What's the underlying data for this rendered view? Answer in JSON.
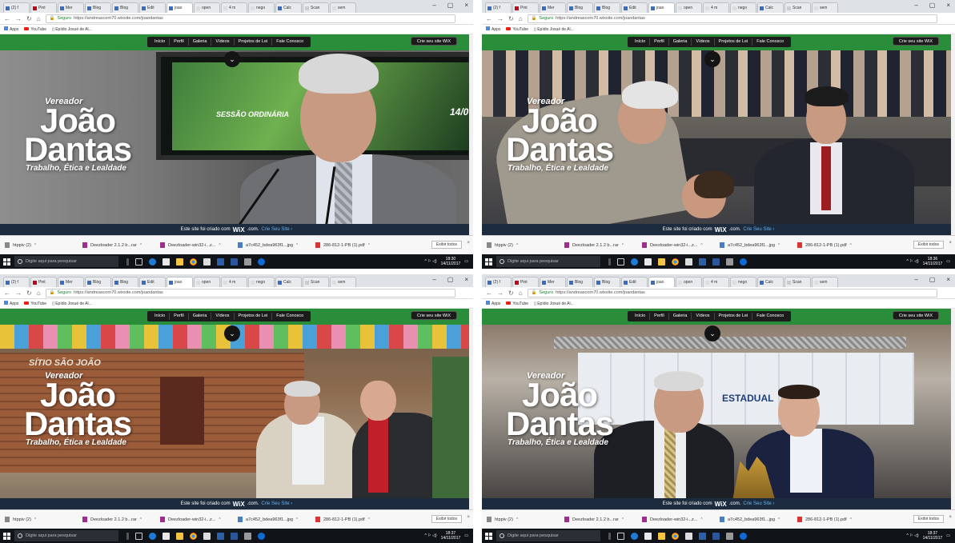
{
  "browser": {
    "tabs": [
      "(2) f",
      "Pint",
      "Mer",
      "Blog",
      "Blog",
      "Edit",
      "joao",
      "open",
      "4 m",
      "nego",
      "Calc",
      "Scan",
      "sem"
    ],
    "active_tab_index": 6,
    "url_secure": "Seguro",
    "url": "https://andreascorn70.wixsite.com/joaodantas",
    "bookmarks": [
      "Apps",
      "YouTube",
      "Epídio Josué de Al..."
    ],
    "window_controls": [
      "–",
      "▢",
      "×"
    ]
  },
  "site": {
    "menu": [
      "Início",
      "Perfil",
      "Galeria",
      "Vídeos",
      "Projetos de Lei",
      "Fale Conosco"
    ],
    "wix_cta": "Crie seu site WiX",
    "brand_top": "Vereador",
    "brand_name_1": "João",
    "brand_name_2": "Dantas",
    "slogan": "Trabalho, Ética e Lealdade",
    "wix_banner_prefix": "Este site foi criado com",
    "wix_banner_brand": "WiX",
    "wix_banner_suffix": ".com.",
    "wix_banner_link": "Crie Seu Site ›",
    "sign_sitio": "SÍTIO SÃO JOÃO",
    "sign_sessao": "SESSÃO ORDINÁRIA",
    "sign_date": "14/0",
    "banner_estadual": "ESTADUAL"
  },
  "downloads": {
    "items": [
      "htppiv (2)",
      "Deezloader 2.1.2 b...rar",
      "Deezloader-win32-i...z...",
      "a7c452_bdea963f1...jpg",
      "286-812-1-PB (1).pdf"
    ],
    "show_all": "Exibir todos"
  },
  "taskbar": {
    "search_placeholder": "Digite aqui para pesquisar",
    "time_1": "18:30",
    "time_2": "18:36",
    "time_3": "18:37",
    "date": "14/11/2017"
  },
  "colors": {
    "site_green": "#2a8d3a",
    "wix_bar": "#1d2b3e",
    "taskbar": "#101419"
  }
}
